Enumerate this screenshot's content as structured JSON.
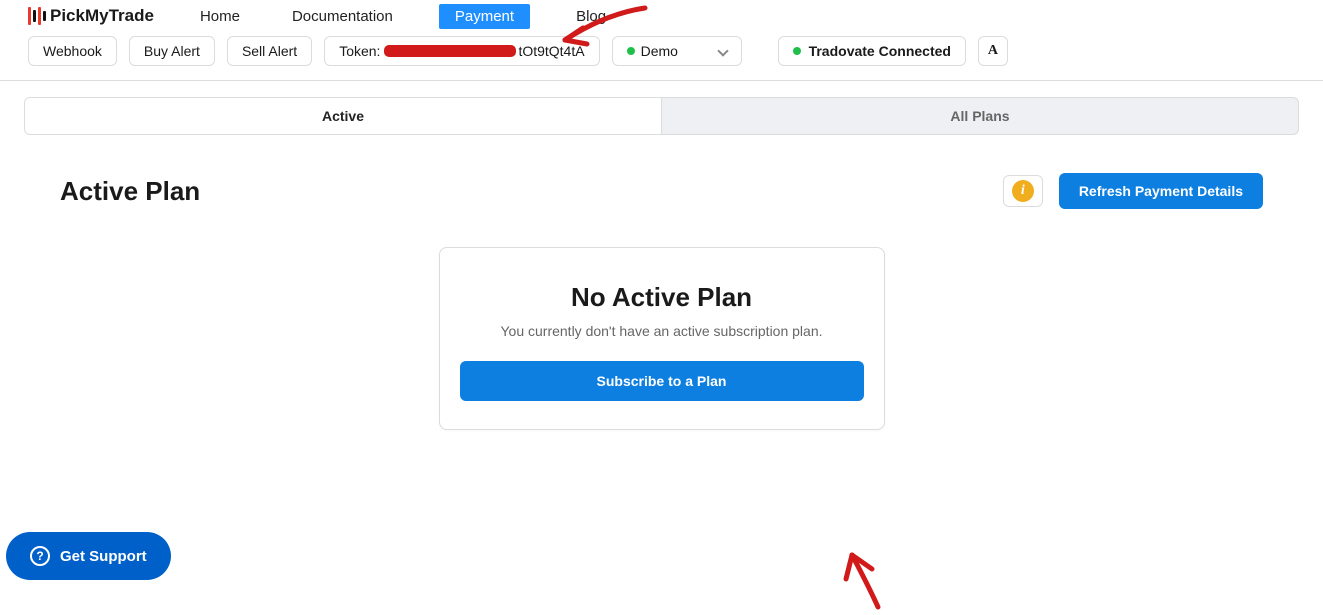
{
  "brand": "PickMyTrade",
  "nav": {
    "home": "Home",
    "documentation": "Documentation",
    "payment": "Payment",
    "blog": "Blog"
  },
  "toolbar": {
    "webhook": "Webhook",
    "buy_alert": "Buy Alert",
    "sell_alert": "Sell Alert",
    "token_label": "Token:",
    "token_suffix": "tOt9tQt4tA",
    "env_selected": "Demo",
    "connection": "Tradovate Connected",
    "avatar": "A"
  },
  "tabs": {
    "active": "Active",
    "all_plans": "All Plans"
  },
  "page": {
    "heading": "Active Plan",
    "info_letter": "i",
    "refresh": "Refresh Payment Details"
  },
  "card": {
    "title": "No Active Plan",
    "subtitle": "You currently don't have an active subscription plan.",
    "cta": "Subscribe to a Plan"
  },
  "support": {
    "label": "Get Support",
    "icon": "?"
  }
}
